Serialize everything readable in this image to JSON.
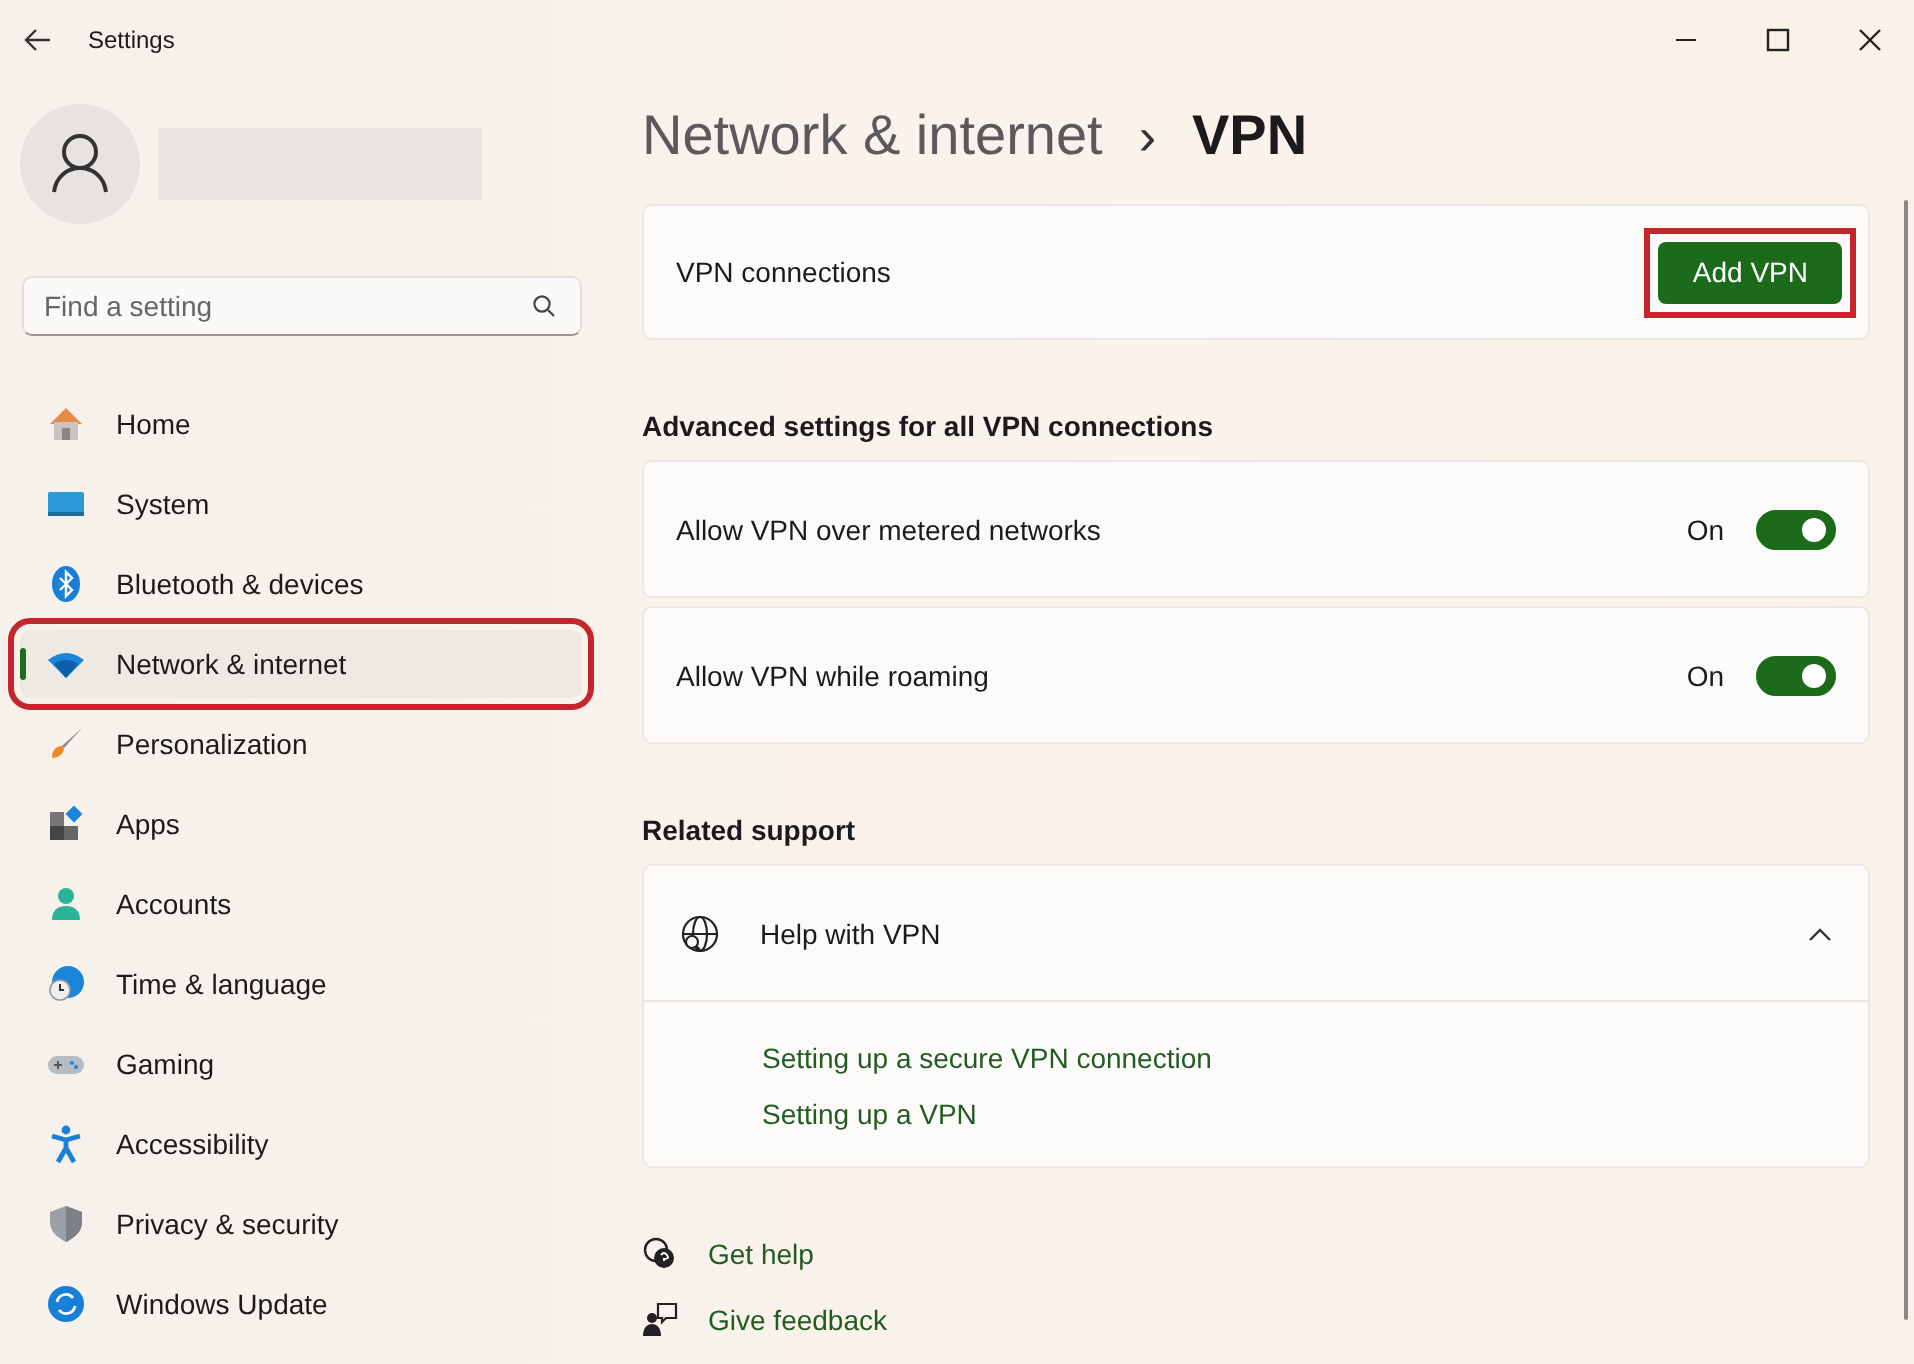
{
  "window": {
    "title": "Settings"
  },
  "search": {
    "placeholder": "Find a setting"
  },
  "nav": [
    {
      "label": "Home",
      "selected": false,
      "highlighted": false
    },
    {
      "label": "System",
      "selected": false,
      "highlighted": false
    },
    {
      "label": "Bluetooth & devices",
      "selected": false,
      "highlighted": false
    },
    {
      "label": "Network & internet",
      "selected": true,
      "highlighted": true
    },
    {
      "label": "Personalization",
      "selected": false,
      "highlighted": false
    },
    {
      "label": "Apps",
      "selected": false,
      "highlighted": false
    },
    {
      "label": "Accounts",
      "selected": false,
      "highlighted": false
    },
    {
      "label": "Time & language",
      "selected": false,
      "highlighted": false
    },
    {
      "label": "Gaming",
      "selected": false,
      "highlighted": false
    },
    {
      "label": "Accessibility",
      "selected": false,
      "highlighted": false
    },
    {
      "label": "Privacy & security",
      "selected": false,
      "highlighted": false
    },
    {
      "label": "Windows Update",
      "selected": false,
      "highlighted": false
    }
  ],
  "breadcrumb": {
    "parent": "Network & internet",
    "separator": "›",
    "current": "VPN"
  },
  "vpn_connections": {
    "label": "VPN connections",
    "button": "Add VPN",
    "highlighted": true
  },
  "advanced": {
    "heading": "Advanced settings for all VPN connections",
    "settings": [
      {
        "label": "Allow VPN over metered networks",
        "state_text": "On",
        "on": true
      },
      {
        "label": "Allow VPN while roaming",
        "state_text": "On",
        "on": true
      }
    ]
  },
  "related": {
    "heading": "Related support",
    "expander": {
      "title": "Help with VPN",
      "expanded": true,
      "links": [
        "Setting up a secure VPN connection",
        "Setting up a VPN"
      ]
    }
  },
  "footer_links": [
    "Get help",
    "Give feedback"
  ]
}
